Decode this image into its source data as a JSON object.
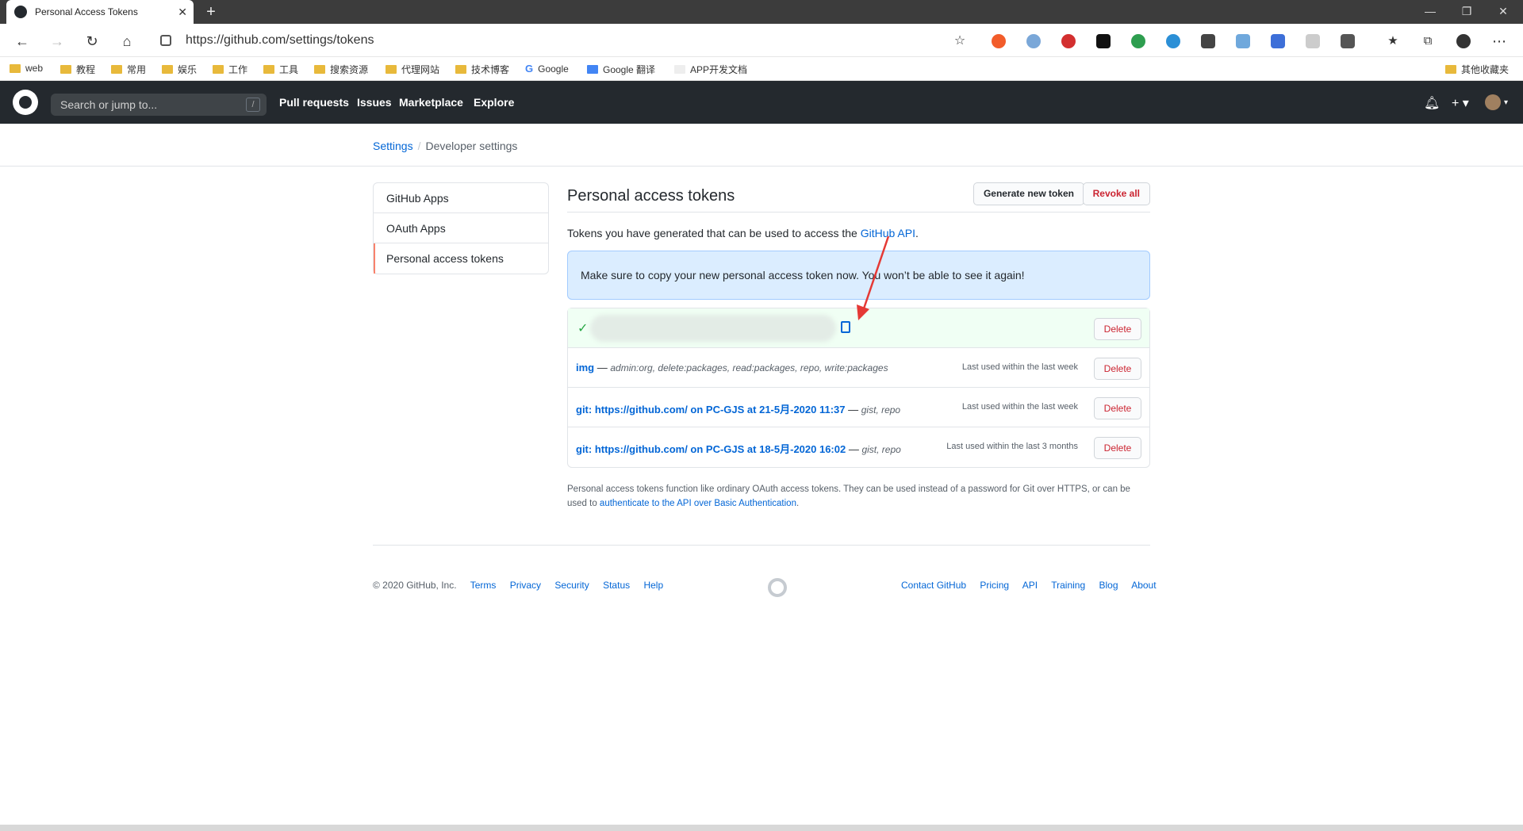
{
  "browser": {
    "tab_title": "Personal Access Tokens",
    "url": "https://github.com/settings/tokens",
    "bookmarks": [
      "web",
      "教程",
      "常用",
      "娱乐",
      "工作",
      "工具",
      "搜索资源",
      "代理网站",
      "技术博客",
      "Google",
      "Google 翻译",
      "APP开发文档"
    ],
    "other_bookmarks": "其他收藏夹"
  },
  "header": {
    "search_placeholder": "Search or jump to...",
    "slash": "/",
    "nav": [
      "Pull requests",
      "Issues",
      "Marketplace",
      "Explore"
    ]
  },
  "breadcrumb": {
    "settings": "Settings",
    "sep": "/",
    "current": "Developer settings"
  },
  "sidebar": {
    "items": [
      {
        "label": "GitHub Apps"
      },
      {
        "label": "OAuth Apps"
      },
      {
        "label": "Personal access tokens"
      }
    ]
  },
  "main": {
    "title": "Personal access tokens",
    "generate_button": "Generate new token",
    "revoke_button": "Revoke all",
    "intro_text": "Tokens you have generated that can be used to access the ",
    "intro_link": "GitHub API",
    "intro_end": ".",
    "flash": "Make sure to copy your new personal access token now. You won’t be able to see it again!",
    "tokens": [
      {
        "name": "img",
        "sep": " — ",
        "scopes": "admin:org, delete:packages, read:packages, repo, write:packages",
        "last_used": "Last used within the last week",
        "delete": "Delete"
      },
      {
        "name": "git: https://github.com/ on PC-GJS at 21-5月-2020 11:37",
        "sep": " — ",
        "scopes": "gist, repo",
        "last_used": "Last used within the last week",
        "delete": "Delete"
      },
      {
        "name": "git: https://github.com/ on PC-GJS at 18-5月-2020 16:02",
        "sep": " — ",
        "scopes": "gist, repo",
        "last_used": "Last used within the last 3 months",
        "delete": "Delete"
      }
    ],
    "new_token_delete": "Delete",
    "note_text": "Personal access tokens function like ordinary OAuth access tokens. They can be used instead of a password for Git over HTTPS, or can be used to ",
    "note_link": "authenticate to the API over Basic Authentication",
    "note_end": "."
  },
  "footer": {
    "copyright": "© 2020 GitHub, Inc.",
    "left_links": [
      "Terms",
      "Privacy",
      "Security",
      "Status",
      "Help"
    ],
    "right_links": [
      "Contact GitHub",
      "Pricing",
      "API",
      "Training",
      "Blog",
      "About"
    ]
  }
}
